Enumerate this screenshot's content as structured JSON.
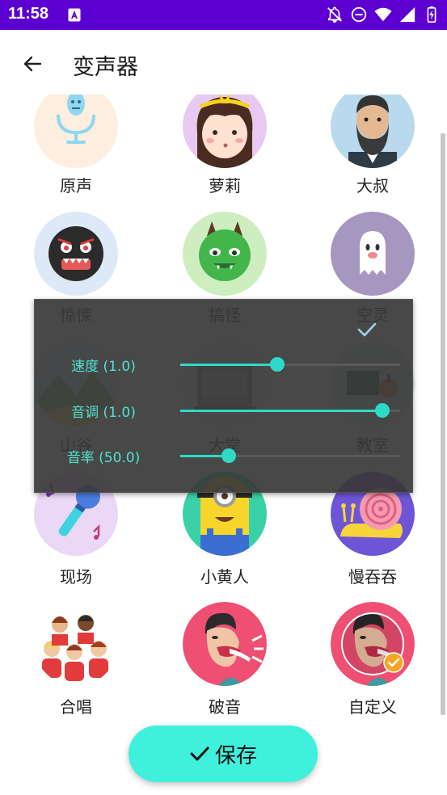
{
  "status_bar": {
    "time": "11:58"
  },
  "app_bar": {
    "title": "变声器"
  },
  "voices": [
    {
      "label": "原声",
      "icon": "microphone-robot-icon"
    },
    {
      "label": "萝莉",
      "icon": "girl-face-icon"
    },
    {
      "label": "大叔",
      "icon": "bearded-man-icon"
    },
    {
      "label": "惊悚",
      "icon": "scary-monster-icon"
    },
    {
      "label": "搞怪",
      "icon": "green-monster-icon"
    },
    {
      "label": "空灵",
      "icon": "ghost-icon"
    },
    {
      "label": "山谷",
      "icon": "valley-icon"
    },
    {
      "label": "大堂",
      "icon": "hall-icon"
    },
    {
      "label": "教室",
      "icon": "classroom-icon"
    },
    {
      "label": "现场",
      "icon": "live-microphone-icon"
    },
    {
      "label": "小黄人",
      "icon": "minion-icon"
    },
    {
      "label": "慢吞吞",
      "icon": "snail-icon"
    },
    {
      "label": "合唱",
      "icon": "choir-icon"
    },
    {
      "label": "破音",
      "icon": "shouting-person-icon"
    },
    {
      "label": "自定义",
      "icon": "custom-voice-icon"
    }
  ],
  "selected_voice": "自定义",
  "dialog": {
    "sliders": [
      {
        "label": "速度 (1.0)",
        "level": 0.44
      },
      {
        "label": "音调 (1.0)",
        "level": 0.92
      },
      {
        "label": "音率 (50.0)",
        "level": 0.22
      }
    ]
  },
  "save_button": {
    "label": "保存"
  },
  "colors": {
    "status_bar": "#5c00d2",
    "accent": "#2fd9c8",
    "save_bg": "#3ff1dd",
    "selected_badge": "#f5a623"
  }
}
